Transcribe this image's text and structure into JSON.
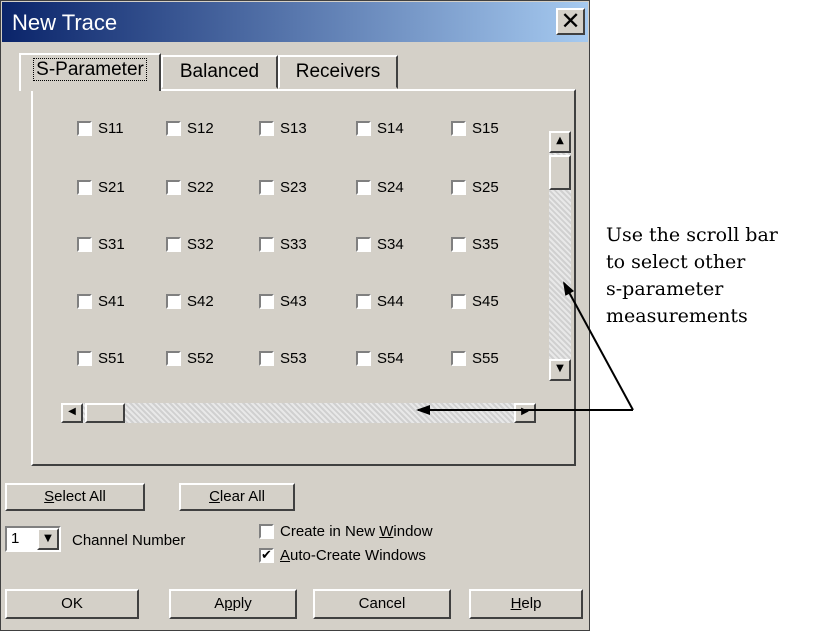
{
  "dialog": {
    "title": "New Trace"
  },
  "tabs": [
    {
      "label": "S-Parameter",
      "active": true
    },
    {
      "label": "Balanced",
      "active": false
    },
    {
      "label": "Receivers",
      "active": false
    }
  ],
  "sparams": [
    [
      {
        "label": "S11",
        "checked": false
      },
      {
        "label": "S12",
        "checked": false
      },
      {
        "label": "S13",
        "checked": false
      },
      {
        "label": "S14",
        "checked": false
      },
      {
        "label": "S15",
        "checked": false
      }
    ],
    [
      {
        "label": "S21",
        "checked": false
      },
      {
        "label": "S22",
        "checked": false
      },
      {
        "label": "S23",
        "checked": false
      },
      {
        "label": "S24",
        "checked": false
      },
      {
        "label": "S25",
        "checked": false
      }
    ],
    [
      {
        "label": "S31",
        "checked": false
      },
      {
        "label": "S32",
        "checked": false
      },
      {
        "label": "S33",
        "checked": false
      },
      {
        "label": "S34",
        "checked": false
      },
      {
        "label": "S35",
        "checked": false
      }
    ],
    [
      {
        "label": "S41",
        "checked": false
      },
      {
        "label": "S42",
        "checked": false
      },
      {
        "label": "S43",
        "checked": false
      },
      {
        "label": "S44",
        "checked": false
      },
      {
        "label": "S45",
        "checked": false
      }
    ],
    [
      {
        "label": "S51",
        "checked": false
      },
      {
        "label": "S52",
        "checked": false
      },
      {
        "label": "S53",
        "checked": false
      },
      {
        "label": "S54",
        "checked": false
      },
      {
        "label": "S55",
        "checked": false
      }
    ]
  ],
  "buttons": {
    "select_all": {
      "pre": "",
      "u": "S",
      "post": "elect All"
    },
    "clear_all": {
      "pre": "",
      "u": "C",
      "post": "lear All"
    },
    "ok": "OK",
    "apply": {
      "pre": "A",
      "u": "p",
      "post": "ply"
    },
    "cancel": "Cancel",
    "help": {
      "pre": "",
      "u": "H",
      "post": "elp"
    }
  },
  "channel": {
    "value": "1",
    "label": "Channel Number"
  },
  "options": {
    "create_new_window": {
      "pre": "Create in New ",
      "u": "W",
      "post": "indow",
      "checked": false
    },
    "auto_create": {
      "pre": "",
      "u": "A",
      "post": "uto-Create Windows",
      "checked": true
    }
  },
  "annotation": {
    "lines": [
      "Use the scroll bar",
      "to select other",
      "s-parameter",
      "measurements"
    ]
  },
  "icons": {
    "close": "close-icon",
    "scroll_up": "arrow-up-icon",
    "scroll_down": "arrow-down-icon",
    "scroll_left": "arrow-left-icon",
    "scroll_right": "arrow-right-icon",
    "dropdown": "chevron-down-icon",
    "check": "checkmark-icon"
  }
}
